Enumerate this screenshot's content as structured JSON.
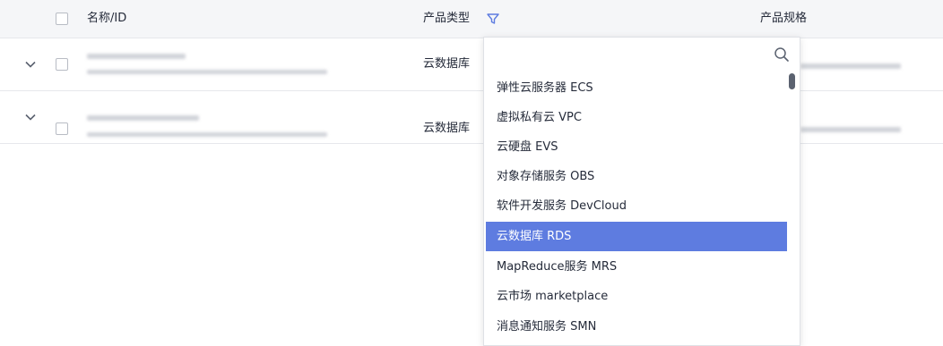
{
  "table": {
    "headers": {
      "name": "名称/ID",
      "product_type": "产品类型",
      "product_spec": "产品规格"
    },
    "rows": [
      {
        "type": "云数据库"
      },
      {
        "type": "云数据库"
      }
    ]
  },
  "filter_dropdown": {
    "search_placeholder": "",
    "options": [
      "弹性云服务器 ECS",
      "虚拟私有云 VPC",
      "云硬盘 EVS",
      "对象存储服务 OBS",
      "软件开发服务 DevCloud",
      "云数据库 RDS",
      "MapReduce服务 MRS",
      "云市场 marketplace",
      "消息通知服务 SMN"
    ],
    "selected_option": "云数据库 RDS"
  },
  "colors": {
    "accent": "#5e7ce0",
    "header_bg": "#f5f6f8",
    "border": "#e6e8ec"
  }
}
